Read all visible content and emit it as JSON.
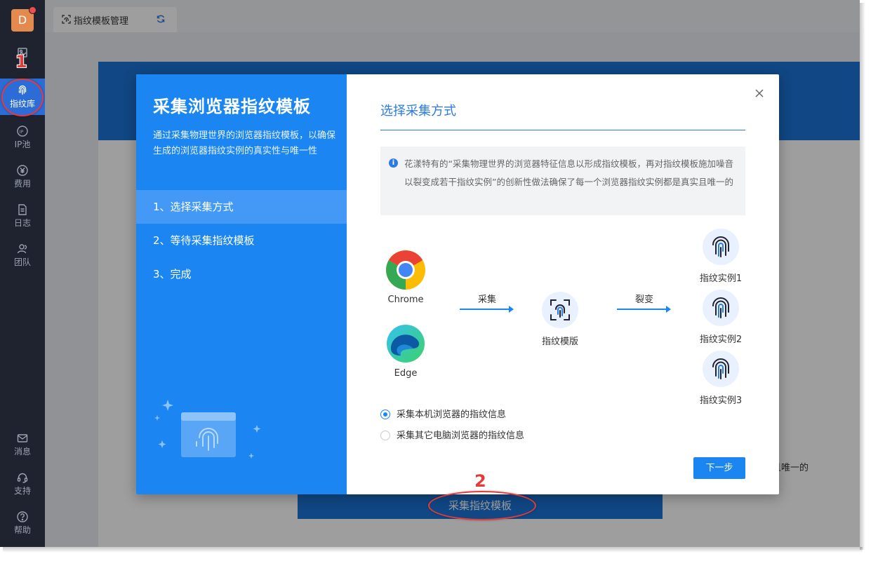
{
  "sidebar": {
    "avatar_letter": "D",
    "items": [
      {
        "label": ""
      },
      {
        "label": "指纹库"
      },
      {
        "label": "IP池"
      },
      {
        "label": "费用"
      },
      {
        "label": "日志"
      },
      {
        "label": "团队"
      }
    ],
    "bottom_items": [
      {
        "label": "消息"
      },
      {
        "label": "支持"
      },
      {
        "label": "帮助"
      }
    ]
  },
  "tabbar": {
    "tab_label": "指纹模板管理"
  },
  "page": {
    "side_text": "且唯一的",
    "collect_button": "采集指纹模板"
  },
  "modal": {
    "left": {
      "title": "采集浏览器指纹模板",
      "description": "通过采集物理世界的浏览器指纹模板，以确保生成的浏览器指纹实例的真实性与唯一性",
      "steps": [
        {
          "label": "1、选择采集方式"
        },
        {
          "label": "2、等待采集指纹模板"
        },
        {
          "label": "3、完成"
        }
      ]
    },
    "right": {
      "title": "选择采集方式",
      "notice": "花漾特有的“采集物理世界的浏览器特征信息以形成指纹模板，再对指纹模板施加噪音以裂变成若干指纹实例”的创新性做法确保了每一个浏览器指纹实例都是真实且唯一的",
      "browsers": [
        {
          "name": "Chrome"
        },
        {
          "name": "Edge"
        }
      ],
      "collect_label": "采集",
      "template_label": "指纹模版",
      "split_label": "裂变",
      "instances": [
        {
          "label": "指纹实例1"
        },
        {
          "label": "指纹实例2"
        },
        {
          "label": "指纹实例3"
        }
      ],
      "options": [
        {
          "label": "采集本机浏览器的指纹信息",
          "checked": true
        },
        {
          "label": "采集其它电脑浏览器的指纹信息",
          "checked": false
        }
      ],
      "next_button": "下一步"
    }
  },
  "annotations": {
    "marker_1": "1",
    "marker_2": "2"
  },
  "colors": {
    "sidebar_bg": "#1f2330",
    "accent": "#1b86f2",
    "annotation": "#e33b3b"
  }
}
